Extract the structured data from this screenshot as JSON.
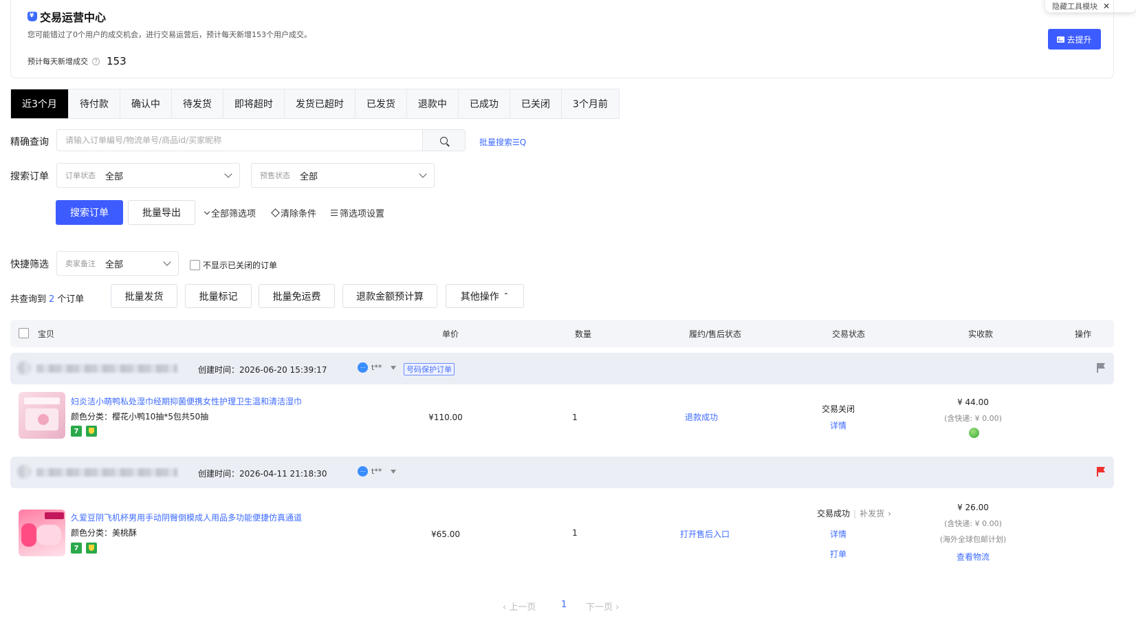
{
  "float_tip": {
    "label": "隐藏工具模块",
    "close": "✕"
  },
  "ops": {
    "title": "交易运营中心",
    "desc": "您可能错过了0个用户的成交机会，进行交易运营后，预计每天新增153个用户成交。",
    "metric_label": "预计每天新增成交",
    "metric_value": "153",
    "improve_btn": "去提升",
    "accent": "#3d5cff"
  },
  "tabs": [
    "近3个月",
    "待付款",
    "确认中",
    "待发货",
    "即将超时",
    "发货已超时",
    "已发货",
    "退款中",
    "已成功",
    "已关闭",
    "3个月前"
  ],
  "active_tab": "近3个月",
  "search": {
    "label": "精确查询",
    "placeholder": "请输入订单编号/物流单号/商品id/买家昵称",
    "batch_search": "批量搜索☰Q"
  },
  "filters": {
    "label": "搜索订单",
    "order_status": {
      "prefix": "订单状态",
      "value": "全部"
    },
    "presale_status": {
      "prefix": "预售状态",
      "value": "全部"
    }
  },
  "actions": {
    "search_btn": "搜索订单",
    "export_btn": "批量导出",
    "all_filters": "全部筛选项",
    "clear": "清除条件",
    "settings": "筛选项设置"
  },
  "quick": {
    "label": "快捷筛选",
    "seller_note": {
      "prefix": "卖家备注",
      "value": "全部"
    },
    "hide_closed": "不显示已关闭的订单"
  },
  "summary": {
    "prefix": "共查询到",
    "count": "2",
    "suffix": "个订单"
  },
  "bulk": [
    "批量发货",
    "批量标记",
    "批量免运费",
    "退款金额预计算",
    "其他操作"
  ],
  "table_headers": [
    "宝贝",
    "单价",
    "数量",
    "履约/售后状态",
    "交易状态",
    "实收款",
    "操作"
  ],
  "orders": [
    {
      "created": "创建时间：2026-06-20 15:39:17",
      "buyer": "t**",
      "tag": "号码保护订单",
      "flag_color": "#8a8f99",
      "title": "妇炎洁小萌鸭私处湿巾经期抑菌便携女性护理卫生温和清洁湿巾",
      "spec": "颜色分类：樱花小鸭10抽*5包共50抽",
      "unit_price": "¥110.00",
      "qty": "1",
      "fulfil": "退款成功",
      "trade_status": "交易关闭",
      "detail": "详情",
      "paid": "¥ 44.00",
      "shipping": "(含快递: ¥ 0.00)",
      "badges": [
        "7",
        "shield"
      ]
    },
    {
      "created": "创建时间：2026-04-11 21:18:30",
      "buyer": "t**",
      "flag_color": "#f0302d",
      "title": "久爱豆阴飞机杯男用手动阴臀倒模成人用品多功能便捷仿真通道",
      "spec": "颜色分类：美桃酥",
      "unit_price": "¥65.00",
      "qty": "1",
      "fulfil": "打开售后入口",
      "trade_status": "交易成功",
      "resend": "补发货",
      "detail": "详情",
      "print": "打单",
      "paid": "¥ 26.00",
      "shipping": "(含快递: ¥ 0.00)",
      "shipping_note": "(海外全球包邮计划)",
      "logistics": "查看物流",
      "badges": [
        "7",
        "shield"
      ]
    }
  ],
  "pager": {
    "prev": "‹ 上一页",
    "page": "1",
    "next": "下一页 ›"
  }
}
